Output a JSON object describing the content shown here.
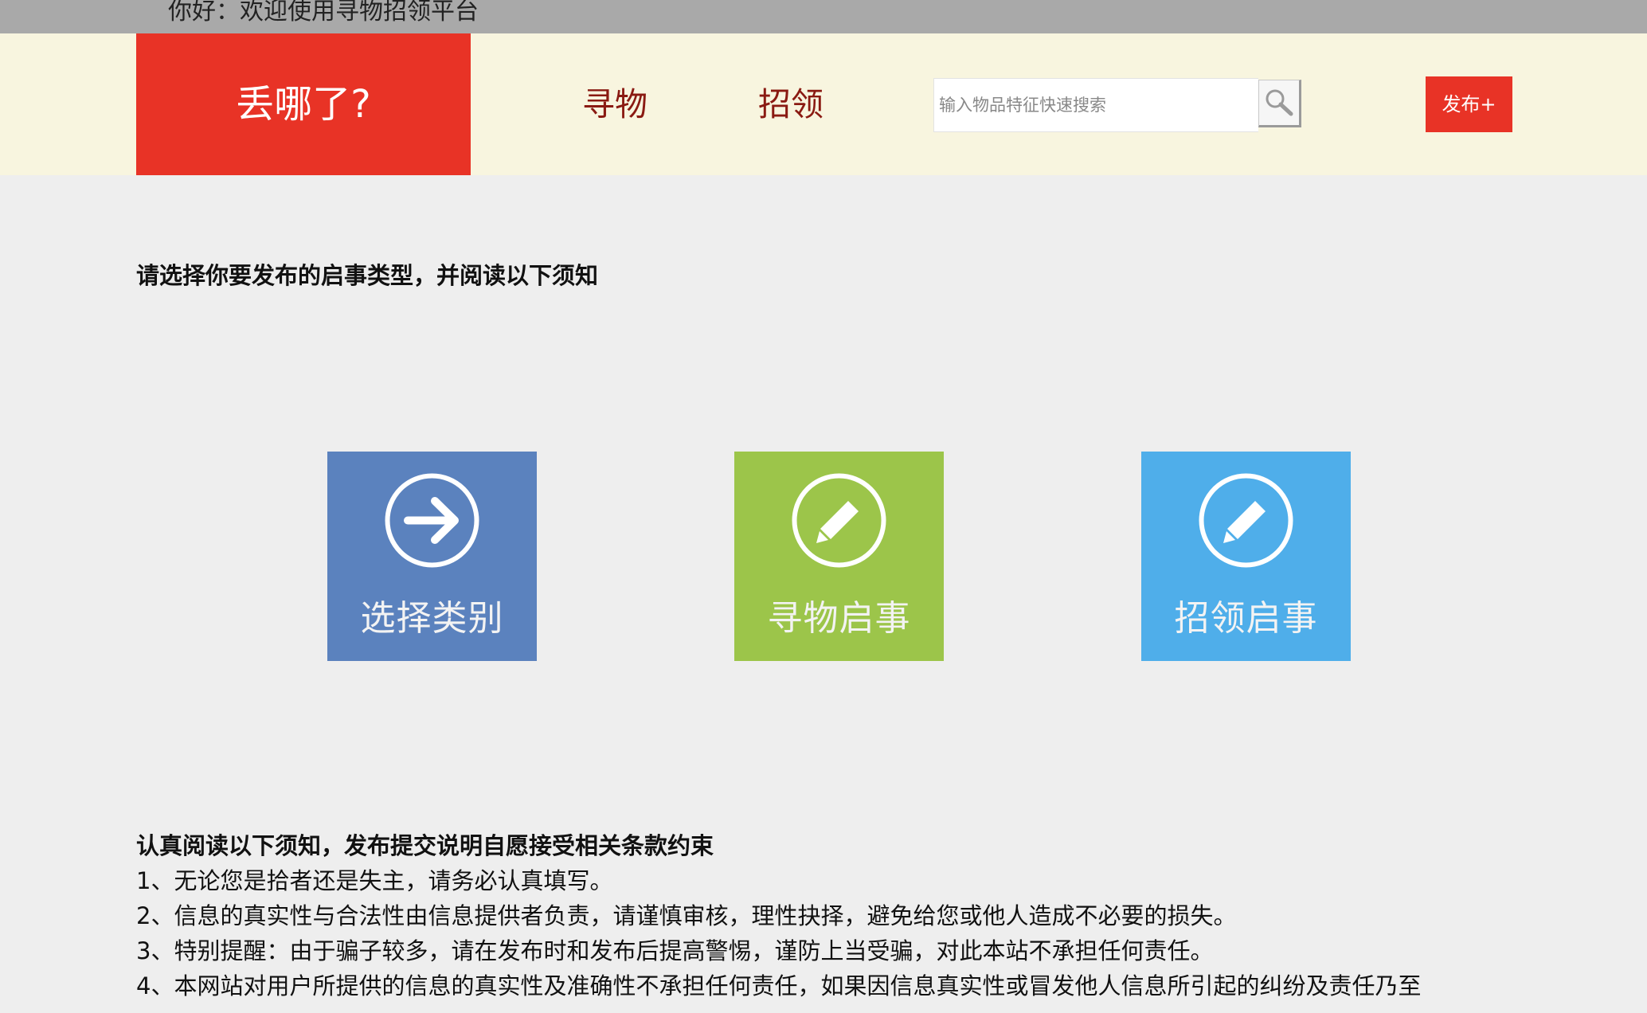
{
  "topbar": {
    "greeting": "你好：欢迎使用寻物招领平台"
  },
  "header": {
    "logo": "丢哪了?",
    "nav": {
      "find": "寻物",
      "claim": "招领"
    },
    "search": {
      "placeholder": "输入物品特征快速搜索"
    },
    "publish_label": "发布+"
  },
  "main": {
    "title": "请选择你要发布的启事类型，并阅读以下须知",
    "tiles": [
      {
        "label": "选择类别",
        "icon": "arrow-right-icon",
        "color": "#5b82be"
      },
      {
        "label": "寻物启事",
        "icon": "pencil-icon",
        "color": "#9cc54a"
      },
      {
        "label": "招领启事",
        "icon": "pencil-icon",
        "color": "#4faeea"
      }
    ]
  },
  "notice": {
    "heading": "认真阅读以下须知，发布提交说明自愿接受相关条款约束",
    "items": [
      "1、无论您是拾者还是失主，请务必认真填写。",
      "2、信息的真实性与合法性由信息提供者负责，请谨慎审核，理性抉择，避免给您或他人造成不必要的损失。",
      "3、特别提醒：由于骗子较多，请在发布时和发布后提高警惕，谨防上当受骗，对此本站不承担任何责任。",
      "4、本网站对用户所提供的信息的真实性及准确性不承担任何责任，如果因信息真实性或冒发他人信息所引起的纠纷及责任乃至"
    ]
  },
  "colors": {
    "brand_red": "#e83326",
    "header_bg": "#f8f5df",
    "nav_text": "#8a1a12"
  }
}
